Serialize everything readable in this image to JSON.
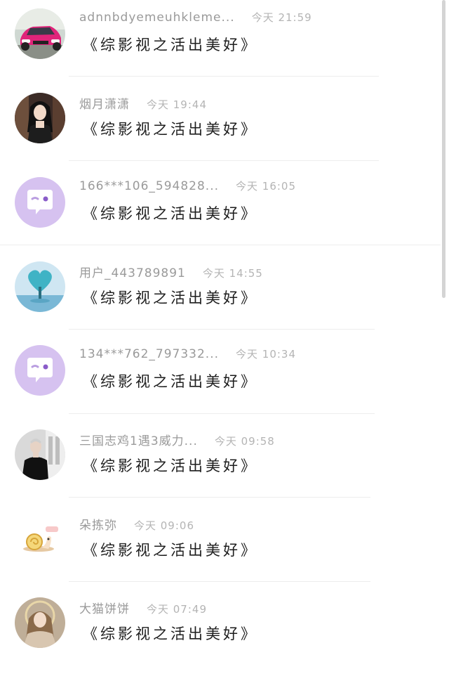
{
  "comments": [
    {
      "username": "adnnbdyemeuhkleme...",
      "time": "今天 21:59",
      "message": "《综影视之活出美好》",
      "avatar_icon": "pink-car-photo-avatar"
    },
    {
      "username": "烟月潇潇",
      "time": "今天 19:44",
      "message": "《综影视之活出美好》",
      "avatar_icon": "woman-portrait-avatar"
    },
    {
      "username": "166***106_594828...",
      "time": "今天 16:05",
      "message": "《综影视之活出美好》",
      "avatar_icon": "default-chat-bubble-avatar"
    },
    {
      "username": "用户_443789891",
      "time": "今天 14:55",
      "message": "《综影视之活出美好》",
      "avatar_icon": "heart-tree-avatar"
    },
    {
      "username": "134***762_797332...",
      "time": "今天 10:34",
      "message": "《综影视之活出美好》",
      "avatar_icon": "default-chat-bubble-avatar"
    },
    {
      "username": "三国志鸡1遇3威力...",
      "time": "今天 09:58",
      "message": "《综影视之活出美好》",
      "avatar_icon": "man-photo-avatar"
    },
    {
      "username": "朵拣弥",
      "time": "今天 09:06",
      "message": "《综影视之活出美好》",
      "avatar_icon": "snail-sticker-avatar"
    },
    {
      "username": "大猫饼饼",
      "time": "今天 07:49",
      "message": "《综影视之活出美好》",
      "avatar_icon": "angel-portrait-avatar"
    }
  ],
  "colors": {
    "default_avatar_bg": "#d6c2f0",
    "default_avatar_fg": "#ffffff",
    "message_text": "#1e1e1e",
    "meta_text": "#a6a6a6"
  }
}
